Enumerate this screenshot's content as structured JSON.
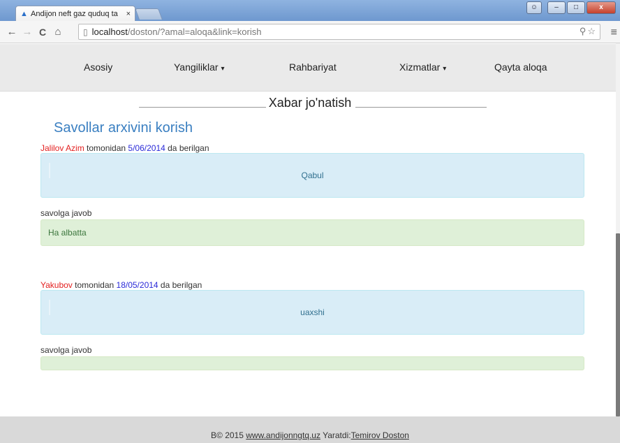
{
  "browser": {
    "tab_title": "Andijon neft gaz quduq ta",
    "tab_close": "×",
    "url_host": "localhost",
    "url_path": "/doston/?amal=aloqa&link=korish",
    "nav_back": "←",
    "nav_forward": "→",
    "nav_reload": "C",
    "nav_home": "⌂",
    "page_icon": "▯",
    "zoom_icon": "⚲",
    "star_icon": "☆",
    "menu_icon": "≡",
    "win_minimize": "–",
    "win_maximize": "□",
    "win_close": "x"
  },
  "navbar": {
    "items": [
      {
        "label": "Asosiy",
        "dropdown": false
      },
      {
        "label": "Yangiliklar",
        "dropdown": true
      },
      {
        "label": "Rahbariyat",
        "dropdown": false
      },
      {
        "label": "Xizmatlar",
        "dropdown": true
      },
      {
        "label": "Qayta aloqa",
        "dropdown": false
      }
    ],
    "caret": "▾"
  },
  "page": {
    "heading": "Xabar jo'natish",
    "archive_title": "Savollar arxivini korish",
    "answer_label": "savolga javob",
    "questions": [
      {
        "name": "Jalilov Azim",
        "by_text": " tomonidan ",
        "date": "5/06/2014",
        "suffix": " da berilgan",
        "question": "Qabul",
        "answer": "Ha albatta"
      },
      {
        "name": "Yakubov",
        "by_text": " tomonidan ",
        "date": "18/05/2014",
        "suffix": " da berilgan",
        "question": "uaxshi",
        "answer": ""
      }
    ]
  },
  "footer": {
    "prefix": "B© 2015 ",
    "site_link": "www.andijonngtq.uz",
    "middle": " Yaratdi:",
    "author_link": "Temirov Doston"
  },
  "colors": {
    "link_blue": "#3a7fc1",
    "name_red": "#e32020",
    "date_blue": "#2a2ad8",
    "question_bg": "#d9edf7",
    "answer_bg": "#dff0d8"
  }
}
